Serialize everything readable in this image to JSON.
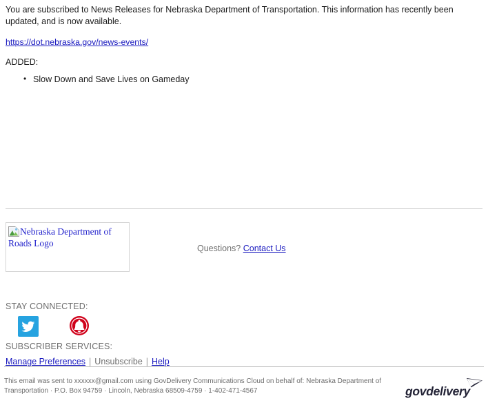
{
  "message": {
    "intro": "You are subscribed to News Releases for Nebraska Department of Transportation. This information has recently been updated, and is now available.",
    "source_link_text": "https://dot.nebraska.gov/news-events/",
    "added_label": "ADDED:",
    "added_items": [
      "Slow Down and Save Lives on Gameday"
    ]
  },
  "brand": {
    "logo_alt_text": "Nebraska Department of Roads Logo",
    "logo_icon": "broken-image-icon",
    "questions_label": "Questions?",
    "contact_link_text": "Contact Us"
  },
  "stay_connected": {
    "heading": "STAY CONNECTED:",
    "icons": [
      {
        "name": "twitter-icon",
        "label": "Twitter",
        "color": "#26a3e0"
      },
      {
        "name": "bell-icon",
        "label": "Email Subscriptions",
        "color": "#d0021b"
      }
    ]
  },
  "subscriber_services": {
    "heading": "SUBSCRIBER SERVICES:",
    "manage_preferences": "Manage Preferences",
    "separator": "|",
    "unsubscribe": "Unsubscribe",
    "help": "Help"
  },
  "footer": {
    "legal_line_1": "This email was sent to xxxxxx@gmail.com using GovDelivery Communications Cloud on behalf of: Nebraska Department of",
    "legal_line_2": "Transportation · P.O. Box 94759 · Lincoln, Nebraska 68509-4759 · 1-402-471-4567",
    "brand_wordmark": "govdelivery",
    "brand_icon": "envelope-icon"
  },
  "colors": {
    "link": "#1919bf",
    "muted_text": "#6d6d6d",
    "rule": "#cfcfcf",
    "twitter_blue": "#26a3e0",
    "bell_red": "#d0021b",
    "govdelivery_navy": "#232336"
  }
}
